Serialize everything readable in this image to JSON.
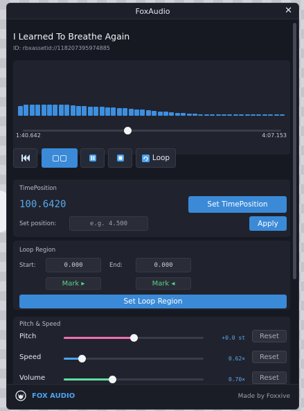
{
  "window": {
    "title": "FoxAudio"
  },
  "song": {
    "title": "I Learned To Breathe Again",
    "id": "ID: rbxassetid://118207395974885"
  },
  "waveform": {
    "levels": [
      0.48,
      0.52,
      0.52,
      0.55,
      0.55,
      0.55,
      0.55,
      0.55,
      0.52,
      0.5,
      0.48,
      0.46,
      0.45,
      0.43,
      0.43,
      0.41,
      0.39,
      0.37,
      0.36,
      0.33,
      0.31,
      0.29,
      0.27,
      0.24,
      0.21,
      0.19,
      0.16,
      0.14,
      0.12,
      0.1,
      0.09,
      0.08,
      0.08,
      0.07,
      0.07,
      0.06,
      0.06,
      0.06,
      0.06,
      0.06,
      0.06,
      0.06,
      0.06,
      0.06,
      0.06,
      0.06
    ]
  },
  "playback": {
    "current": "1:40.642",
    "total": "4:07.153",
    "progress": 0.407
  },
  "controls": {
    "loop_label": "Loop"
  },
  "time_position": {
    "section_label": "TimePosition",
    "value": "100.6420",
    "set_button": "Set TimePosition",
    "set_label": "Set position:",
    "placeholder": "e.g. 4.500",
    "apply_button": "Apply"
  },
  "loop_region": {
    "section_label": "Loop Region",
    "start_label": "Start:",
    "start_value": "0.000",
    "end_label": "End:",
    "end_value": "0.000",
    "mark_start": "Mark ▸",
    "mark_end": "Mark ◂",
    "set_button": "Set Loop Region"
  },
  "pitch_speed": {
    "section_label": "Pitch & Speed",
    "reset_label": "Reset",
    "sliders": [
      {
        "label": "Pitch",
        "value_text": "+0.0 st",
        "level": 0.5,
        "color": "#ef6fb0"
      },
      {
        "label": "Speed",
        "value_text": "0.62×",
        "level": 0.13,
        "color": "#4aa3f0"
      },
      {
        "label": "Volume",
        "value_text": "0.70×",
        "level": 0.35,
        "color": "#5fe0a0"
      }
    ]
  },
  "footer": {
    "brand": "FOX AUDIO",
    "credit": "Made by Foxxive"
  },
  "colors": {
    "accent": "#3b8ad8",
    "background": "#171922"
  }
}
